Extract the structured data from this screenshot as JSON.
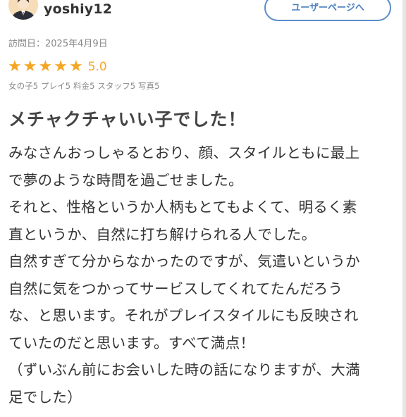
{
  "user": {
    "name": "yoshiy12",
    "page_button_label": "ユーザーページへ"
  },
  "visit_date": "訪問日：2025年4月9日",
  "rating": {
    "stars": [
      "★",
      "★",
      "★",
      "★",
      "★"
    ],
    "score": "5.0",
    "breakdown": "女の子5 プレイ5 料金5 スタッフ5 写真5",
    "star_color": "#f5a623"
  },
  "review": {
    "title": "メチャクチャいい子でした！",
    "lines": [
      "みなさんおっしゃるとおり、顔、スタイルともに最上",
      "で夢のような時間を過ごせました。",
      "それと、性格というか人柄もとてもよくて、明るく素",
      "直というか、自然に打ち解けられる人でした。",
      "自然すぎて分からなかったのですが、気遣いというか",
      "自然に気をつかってサービスしてくれてたんだろう",
      "な、と思います。それがプレイスタイルにも反映され",
      "ていたのだと思います。すべて満点！",
      "（ずいぶん前にお会いした時の話になりますが、大満",
      "足でした）"
    ]
  },
  "colors": {
    "accent": "#4a7fc0",
    "text": "#333333",
    "muted": "#888888"
  },
  "icons": {
    "avatar": "user-avatar-icon",
    "star": "star-icon"
  }
}
